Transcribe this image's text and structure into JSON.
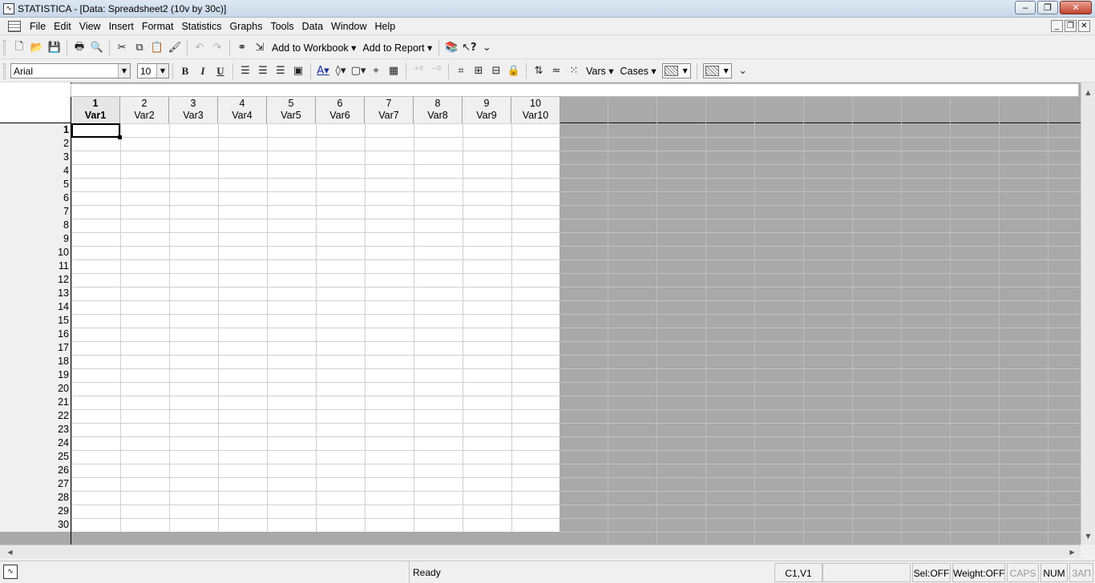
{
  "window": {
    "title": "STATISTICA - [Data: Spreadsheet2 (10v by 30c)]",
    "minimize": "‒",
    "maximize": "❐",
    "close": "✕"
  },
  "menu": {
    "items": [
      "File",
      "Edit",
      "View",
      "Insert",
      "Format",
      "Statistics",
      "Graphs",
      "Tools",
      "Data",
      "Window",
      "Help"
    ]
  },
  "mdi": {
    "minimize": "_",
    "restore": "❐",
    "close": "✕"
  },
  "toolbar1": {
    "add_to_workbook": "Add to Workbook ▾",
    "add_to_report": "Add to Report ▾",
    "help_glyph": "?"
  },
  "toolbar2": {
    "font_name": "Arial",
    "font_size": "10",
    "bold": "B",
    "italic": "I",
    "underline": "U",
    "vars": "Vars ▾",
    "cases": "Cases ▾",
    "dropdown_glyph": "▼"
  },
  "spreadsheet": {
    "columns": [
      {
        "num": "1",
        "name": "Var1"
      },
      {
        "num": "2",
        "name": "Var2"
      },
      {
        "num": "3",
        "name": "Var3"
      },
      {
        "num": "4",
        "name": "Var4"
      },
      {
        "num": "5",
        "name": "Var5"
      },
      {
        "num": "6",
        "name": "Var6"
      },
      {
        "num": "7",
        "name": "Var7"
      },
      {
        "num": "8",
        "name": "Var8"
      },
      {
        "num": "9",
        "name": "Var9"
      },
      {
        "num": "10",
        "name": "Var10"
      }
    ],
    "rows": [
      "1",
      "2",
      "3",
      "4",
      "5",
      "6",
      "7",
      "8",
      "9",
      "10",
      "11",
      "12",
      "13",
      "14",
      "15",
      "16",
      "17",
      "18",
      "19",
      "20",
      "21",
      "22",
      "23",
      "24",
      "25",
      "26",
      "27",
      "28",
      "29",
      "30"
    ]
  },
  "statusbar": {
    "ready": "Ready",
    "cell_ref": "C1,V1",
    "sel": "Sel:OFF",
    "weight": "Weight:OFF",
    "caps": "CAPS",
    "num": "NUM",
    "zap": "ЗАП"
  }
}
